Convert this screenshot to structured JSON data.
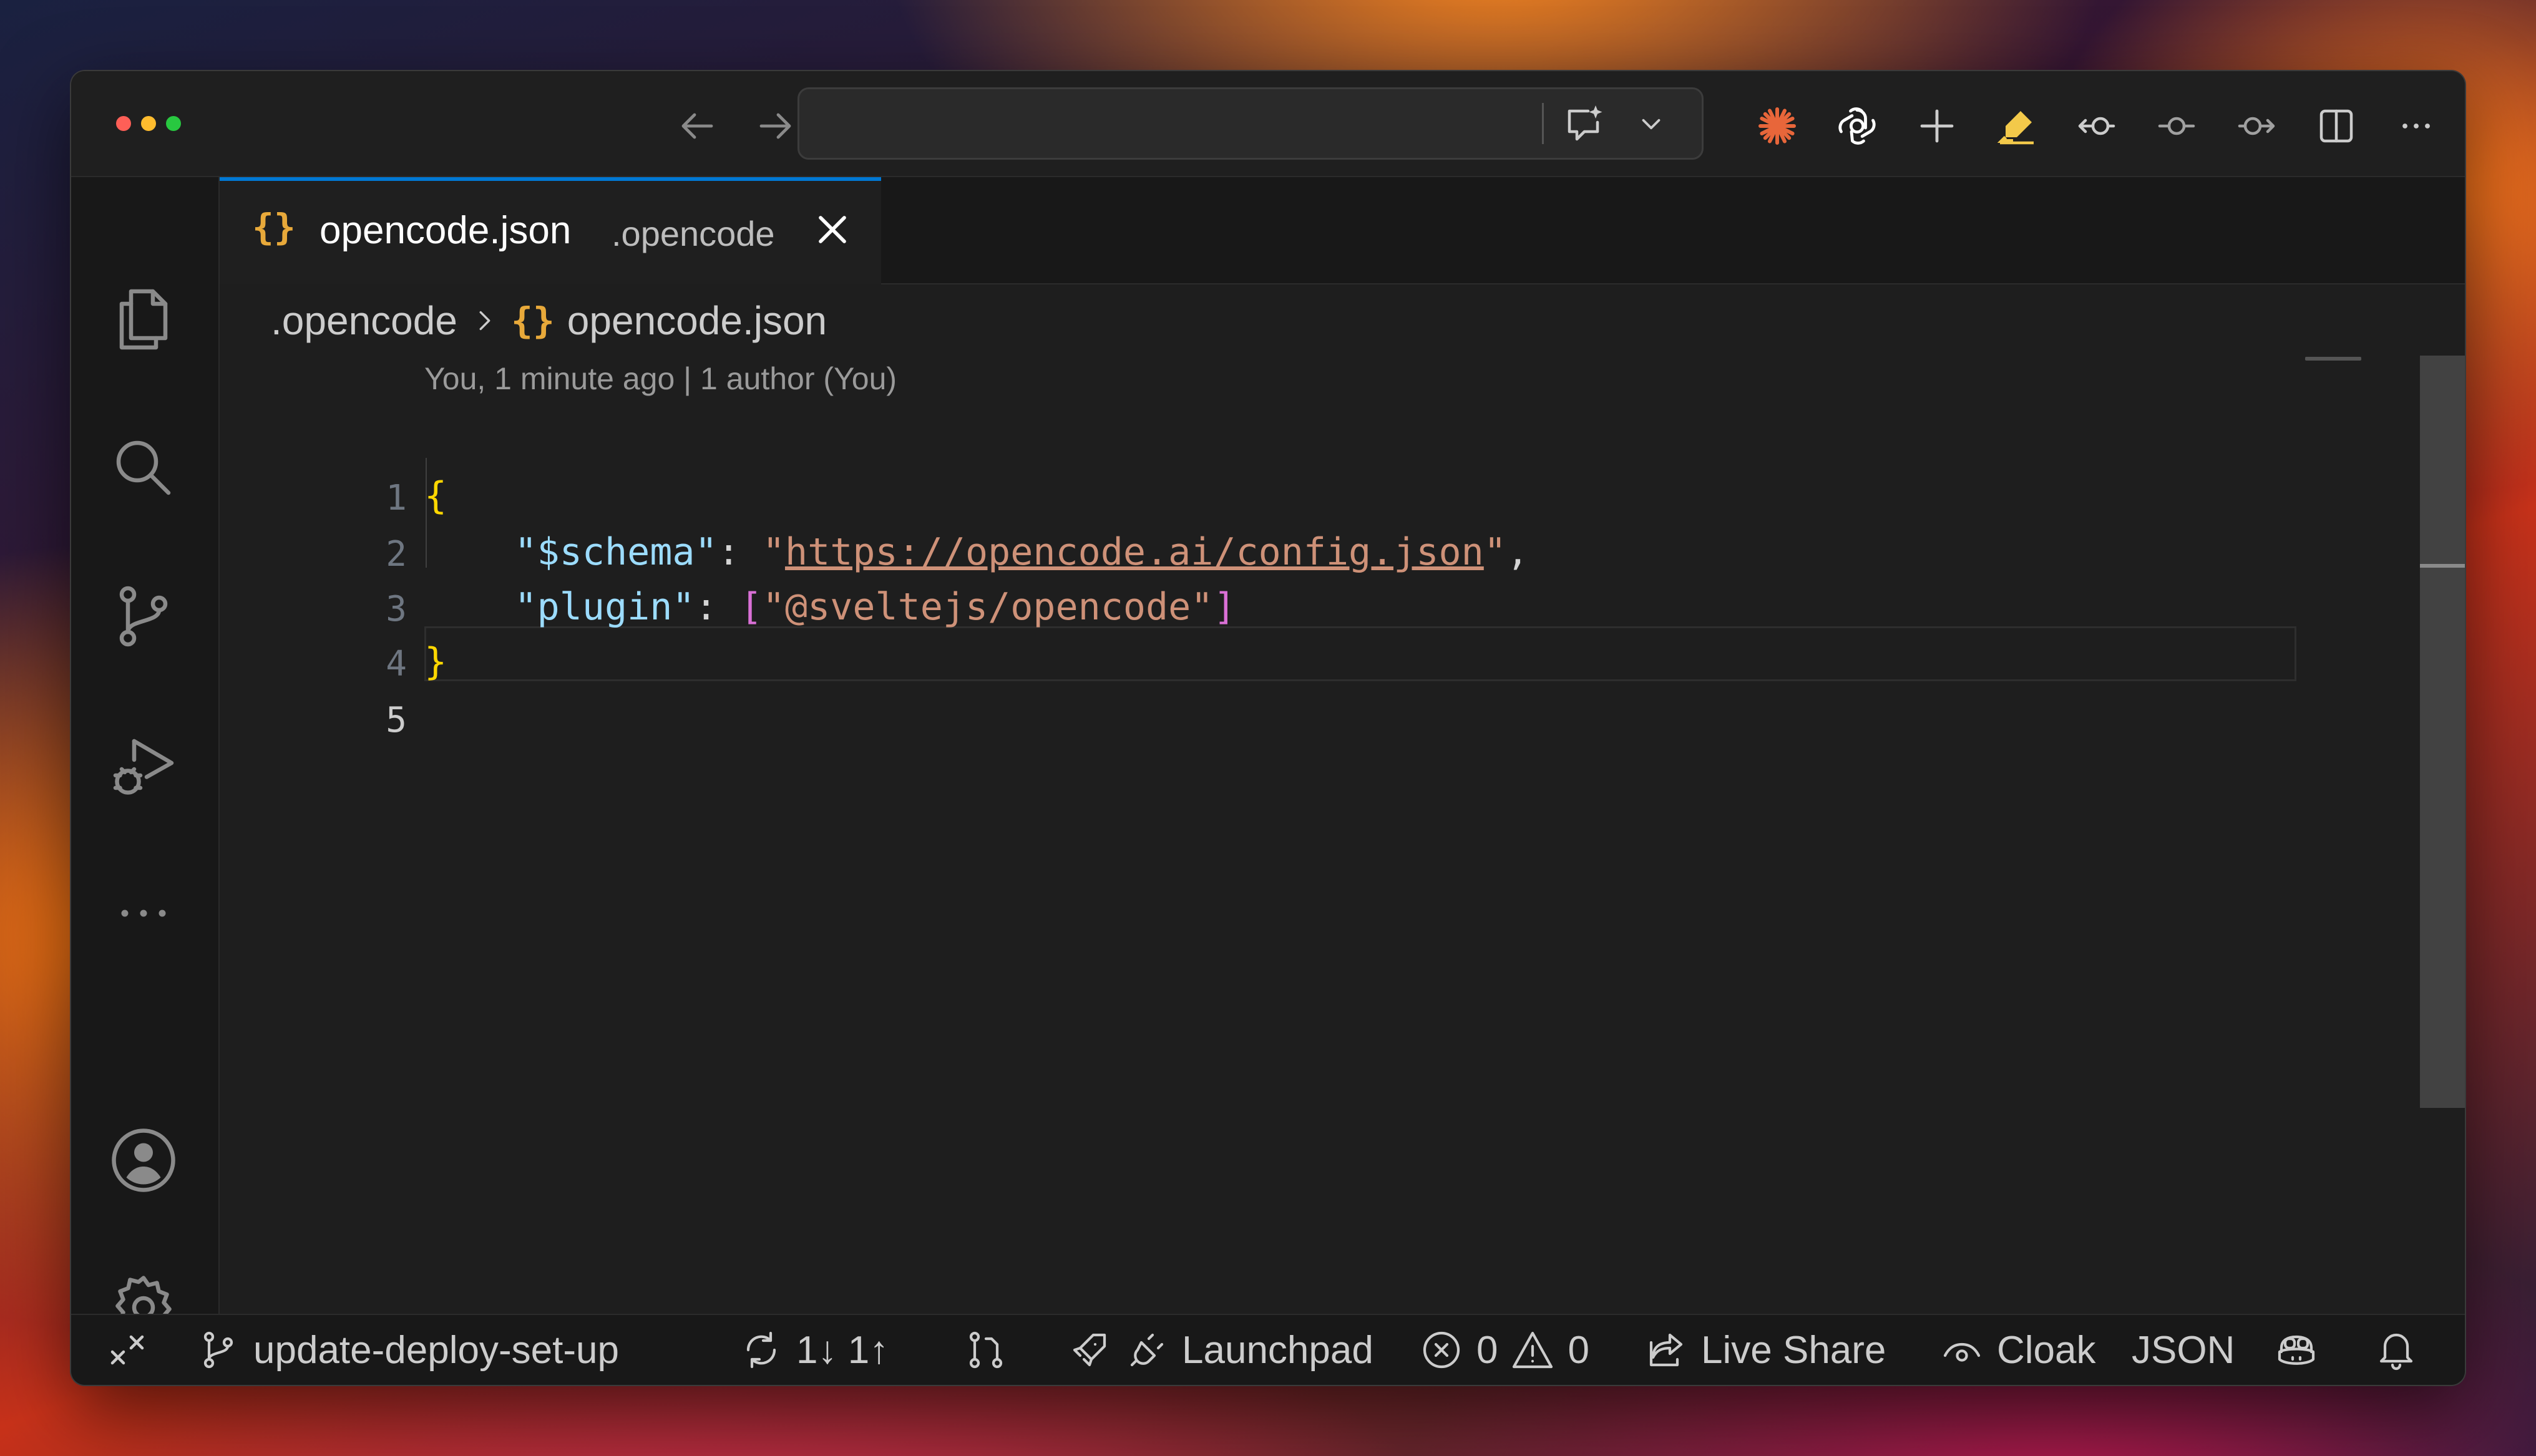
{
  "tab": {
    "icon": "json-braces-icon",
    "braces": "{}",
    "filename": "opencode.json",
    "folder": ".opencode"
  },
  "breadcrumb": {
    "folder": ".opencode",
    "braces": "{}",
    "file": "opencode.json"
  },
  "blame": "You, 1 minute ago | 1 author (You)",
  "lines": [
    "1",
    "2",
    "3",
    "4",
    "5"
  ],
  "code": {
    "l1_open": "{",
    "l2_key": "\"$schema\"",
    "l2_colon": ": ",
    "l2_q1": "\"",
    "l2_url": "https://opencode.ai/config.json",
    "l2_q2": "\"",
    "l2_comma": ",",
    "l3_key": "\"plugin\"",
    "l3_colon": ": ",
    "l3_ob": "[",
    "l3_val": "\"@sveltejs/opencode\"",
    "l3_cb": "]",
    "l4_close": "}"
  },
  "statusbar": {
    "branch": "update-deploy-set-up",
    "sync": "1↓ 1↑",
    "launchpad": "Launchpad",
    "errors": "0",
    "warnings": "0",
    "live_share": "Live Share",
    "cloak": "Cloak",
    "language": "JSON"
  },
  "colors": {
    "accent": "#0078d4",
    "json_icon": "#e8a93a",
    "key": "#9cdcfe",
    "string": "#ce9178",
    "bracket": "#ffd700"
  },
  "icons": {
    "titlebar": [
      "back-arrow-icon",
      "forward-arrow-icon",
      "chat-sparkle-icon",
      "chevron-down-icon",
      "claude-icon",
      "openai-icon",
      "plus-icon",
      "highlighter-icon",
      "timeline-back-icon",
      "commit-icon",
      "timeline-forward-icon",
      "split-editor-icon",
      "more-icon"
    ],
    "activity": [
      "explorer-icon",
      "search-icon",
      "source-control-icon",
      "run-debug-icon",
      "more-icon",
      "account-icon",
      "settings-gear-icon"
    ]
  }
}
